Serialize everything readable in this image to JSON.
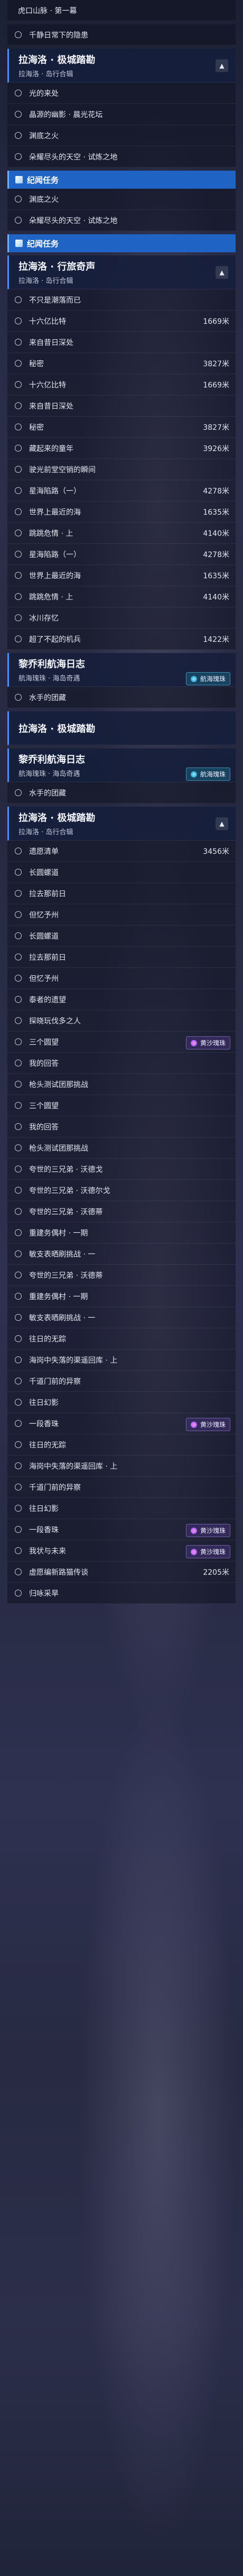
{
  "top": {
    "label": "虎口山脉 · 第一幕"
  },
  "colors": {
    "accent": "#1f63c4",
    "header_bg": "#141e3a",
    "badge_dream": "#342c5c",
    "badge_sea": "#184660"
  },
  "icons": [
    "circle-check-icon",
    "chevron-up-icon",
    "caret-icon",
    "quest-banner-icon",
    "dream-badge-icon",
    "sea-badge-icon"
  ],
  "sections": [
    {
      "type": "row",
      "label": "千静日常下的隐患"
    },
    {
      "type": "header",
      "title": "拉海洛 · 极城踏勘",
      "sub": "拉海洛 · 岛行合辑",
      "caret": "▲"
    },
    {
      "type": "row",
      "label": "光的来处"
    },
    {
      "type": "row",
      "label": "晶源的幽影 · 晨光花坛"
    },
    {
      "type": "row",
      "label": "渊底之火"
    },
    {
      "type": "row",
      "label": "朵耀尽头的天空 · 试炼之地"
    },
    {
      "type": "banner",
      "label": "纪闻任务"
    },
    {
      "type": "row",
      "label": "渊底之火"
    },
    {
      "type": "row",
      "label": "朵耀尽头的天空 · 试炼之地"
    },
    {
      "type": "banner",
      "label": "纪闻任务"
    },
    {
      "type": "header",
      "title": "拉海洛 · 行旅奇声",
      "sub": "拉海洛 · 岛行合辑",
      "caret": "▲"
    },
    {
      "type": "row",
      "label": "不只是潮落而已"
    },
    {
      "type": "row",
      "label": "十六亿比特",
      "dist": "1669米"
    },
    {
      "type": "row",
      "label": "来自昔日深处"
    },
    {
      "type": "row",
      "label": "秘密",
      "dist": "3827米"
    },
    {
      "type": "row",
      "label": "十六亿比特",
      "dist": "1669米"
    },
    {
      "type": "row",
      "label": "来自昔日深处"
    },
    {
      "type": "row",
      "label": "秘密",
      "dist": "3827米"
    },
    {
      "type": "row",
      "label": "藏起来的童年",
      "dist": "3926米"
    },
    {
      "type": "row",
      "label": "驶光前堂空销的瞬间"
    },
    {
      "type": "row",
      "label": "星海陷路（一）",
      "dist": "4278米"
    },
    {
      "type": "row",
      "label": "世界上最近的海",
      "dist": "1635米"
    },
    {
      "type": "row",
      "label": "跳跳危情 · 上",
      "dist": "4140米"
    },
    {
      "type": "row",
      "label": "星海陷路（一）",
      "dist": "4278米"
    },
    {
      "type": "row",
      "label": "世界上最近的海",
      "dist": "1635米"
    },
    {
      "type": "row",
      "label": "跳跳危情 · 上",
      "dist": "4140米"
    },
    {
      "type": "row",
      "label": "冰川存忆"
    },
    {
      "type": "row",
      "label": "超了不起的机兵",
      "dist": "1422米"
    },
    {
      "type": "header",
      "title": "黎乔利航海日志",
      "sub": "航海瑰珠 · 海岛奇遇",
      "caret": "",
      "badge": "航海瑰珠",
      "badgeType": "sea"
    },
    {
      "type": "row",
      "label": "水手的团藏"
    },
    {
      "type": "header",
      "title": "拉海洛 · 极城踏勘",
      "sub": "",
      "caret": ""
    },
    {
      "type": "header",
      "title": "黎乔利航海日志",
      "sub": "航海瑰珠 · 海岛奇遇",
      "caret": "",
      "badge": "航海瑰珠",
      "badgeType": "sea"
    },
    {
      "type": "row",
      "label": "水手的团藏"
    },
    {
      "type": "header",
      "title": "拉海洛 · 极城踏勘",
      "sub": "拉海洛 · 岛行合辑",
      "caret": "▲"
    },
    {
      "type": "row",
      "label": "遗愿清单",
      "dist": "3456米"
    },
    {
      "type": "row",
      "label": "长圆螺道"
    },
    {
      "type": "row",
      "label": "拉去那前日"
    },
    {
      "type": "row",
      "label": "但忆予州"
    },
    {
      "type": "row",
      "label": "长圆螺道"
    },
    {
      "type": "row",
      "label": "拉去那前日"
    },
    {
      "type": "row",
      "label": "但忆予州"
    },
    {
      "type": "row",
      "label": "泰者的遗望"
    },
    {
      "type": "row",
      "label": "探晓玩伐多之人"
    },
    {
      "type": "row",
      "label": "三个圆望",
      "badge": "黄沙瑰珠",
      "badgeType": "dream"
    },
    {
      "type": "row",
      "label": "我的回答"
    },
    {
      "type": "row",
      "label": "枪头测试团那挑战"
    },
    {
      "type": "row",
      "label": "三个圆望"
    },
    {
      "type": "row",
      "label": "我的回答"
    },
    {
      "type": "row",
      "label": "枪头测试团那挑战"
    },
    {
      "type": "row",
      "label": "夸世的三兄弟 · 沃德戈"
    },
    {
      "type": "row",
      "label": "夸世的三兄弟 · 沃德尔戈"
    },
    {
      "type": "row",
      "label": "夸世的三兄弟 · 沃德蒂"
    },
    {
      "type": "row",
      "label": "重建务偶村 · 一期"
    },
    {
      "type": "row",
      "label": "敏支表晒刷挑战 · 一"
    },
    {
      "type": "row",
      "label": "夸世的三兄弟 · 沃德蒂"
    },
    {
      "type": "row",
      "label": "重建务偶村 · 一期"
    },
    {
      "type": "row",
      "label": "敏支表晒刷挑战 · 一"
    },
    {
      "type": "row",
      "label": "往日的无踪"
    },
    {
      "type": "row",
      "label": "海岗中失落的渠遥回库 · 上"
    },
    {
      "type": "row",
      "label": "千道门前的异察"
    },
    {
      "type": "row",
      "label": "往日幻影"
    },
    {
      "type": "row",
      "label": "一段香珠",
      "badge": "黄沙瑰珠",
      "badgeType": "dream"
    },
    {
      "type": "row",
      "label": "往日的无踪"
    },
    {
      "type": "row",
      "label": "海岗中失落的渠遥回库 · 上"
    },
    {
      "type": "row",
      "label": "千道门前的异察"
    },
    {
      "type": "row",
      "label": "往日幻影"
    },
    {
      "type": "row",
      "label": "一段香珠",
      "badge": "黄沙瑰珠",
      "badgeType": "dream"
    },
    {
      "type": "row",
      "label": "我状与未来",
      "badge": "黄沙瑰珠",
      "badgeType": "dream"
    },
    {
      "type": "row",
      "label": "虚愿编新路猫传谈",
      "dist": "2205米"
    },
    {
      "type": "row",
      "label": "归咏采旱"
    }
  ]
}
